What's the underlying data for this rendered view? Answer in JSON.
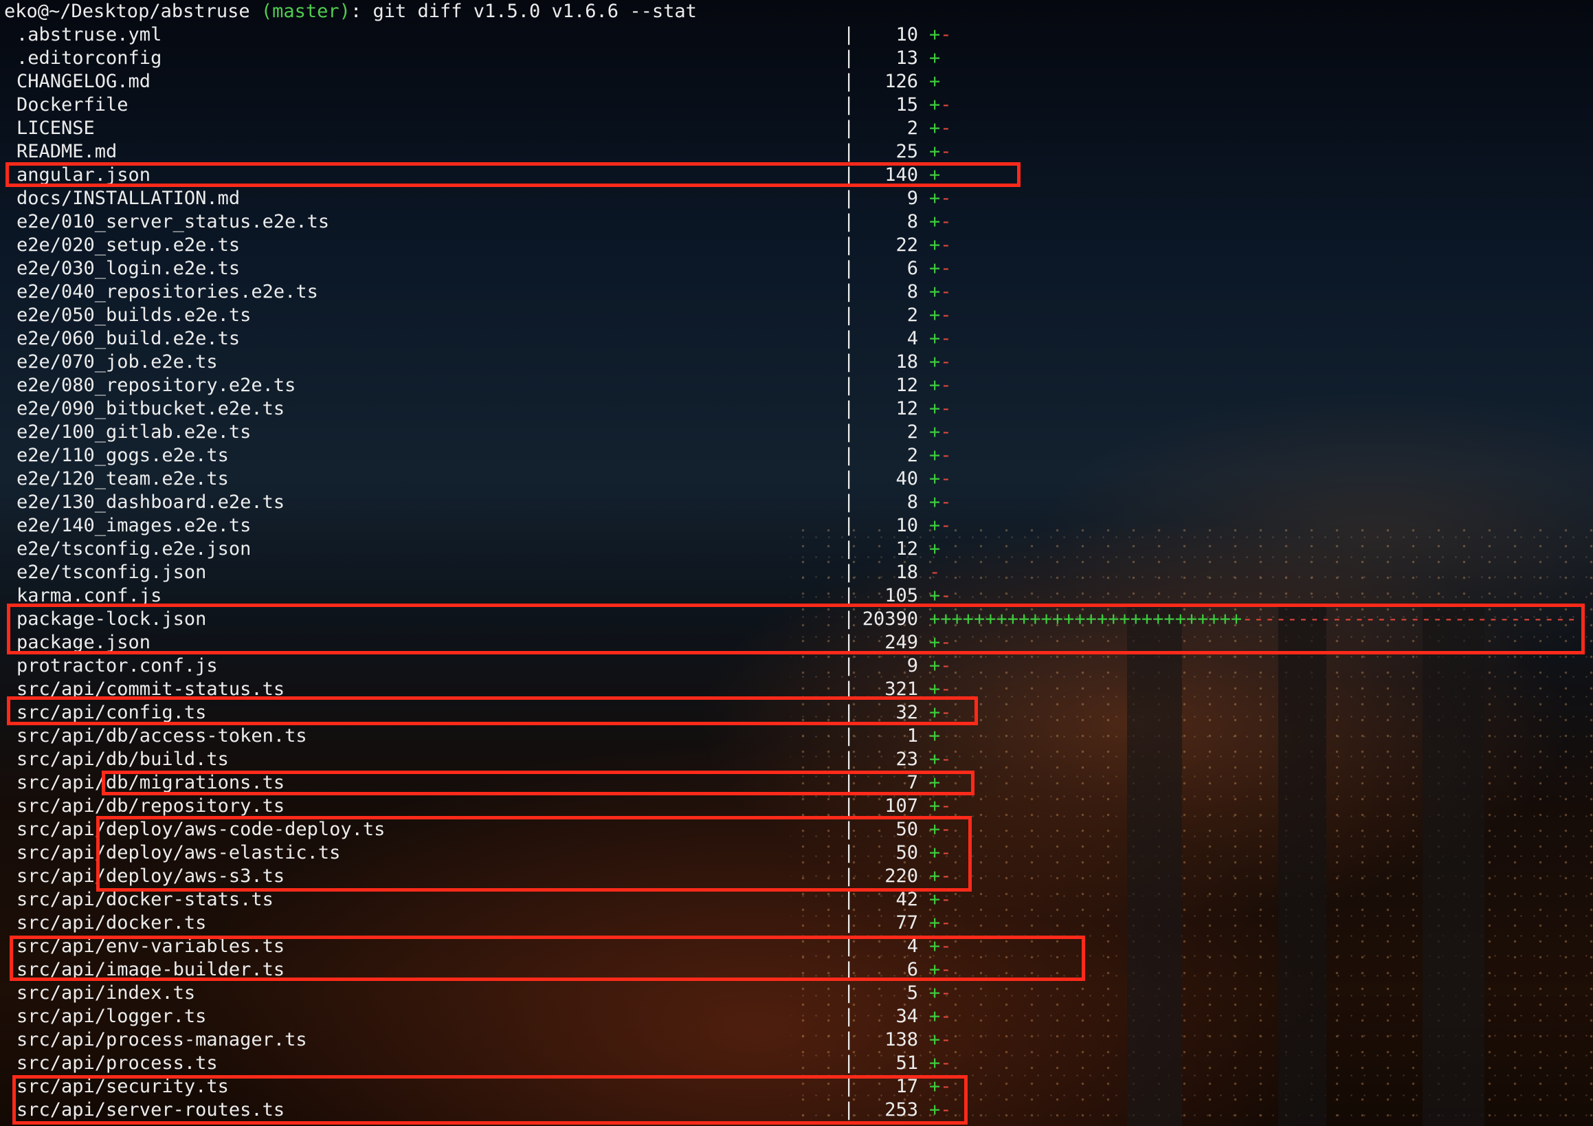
{
  "terminal": {
    "prompt_user": "eko@~/Desktop/abstruse",
    "prompt_branch": "(master)",
    "prompt_command": ": git diff v1.5.0 v1.6.6 --stat"
  },
  "files": [
    {
      "name": ".abstruse.yml",
      "count": "10",
      "plus": "+",
      "minus": "-"
    },
    {
      "name": ".editorconfig",
      "count": "13",
      "plus": "+",
      "minus": ""
    },
    {
      "name": "CHANGELOG.md",
      "count": "126",
      "plus": "+",
      "minus": ""
    },
    {
      "name": "Dockerfile",
      "count": "15",
      "plus": "+",
      "minus": "-"
    },
    {
      "name": "LICENSE",
      "count": "2",
      "plus": "+",
      "minus": "-"
    },
    {
      "name": "README.md",
      "count": "25",
      "plus": "+",
      "minus": "-"
    },
    {
      "name": "angular.json",
      "count": "140",
      "plus": "+",
      "minus": ""
    },
    {
      "name": "docs/INSTALLATION.md",
      "count": "9",
      "plus": "+",
      "minus": "-"
    },
    {
      "name": "e2e/010_server_status.e2e.ts",
      "count": "8",
      "plus": "+",
      "minus": "-"
    },
    {
      "name": "e2e/020_setup.e2e.ts",
      "count": "22",
      "plus": "+",
      "minus": "-"
    },
    {
      "name": "e2e/030_login.e2e.ts",
      "count": "6",
      "plus": "+",
      "minus": "-"
    },
    {
      "name": "e2e/040_repositories.e2e.ts",
      "count": "8",
      "plus": "+",
      "minus": "-"
    },
    {
      "name": "e2e/050_builds.e2e.ts",
      "count": "2",
      "plus": "+",
      "minus": "-"
    },
    {
      "name": "e2e/060_build.e2e.ts",
      "count": "4",
      "plus": "+",
      "minus": "-"
    },
    {
      "name": "e2e/070_job.e2e.ts",
      "count": "18",
      "plus": "+",
      "minus": "-"
    },
    {
      "name": "e2e/080_repository.e2e.ts",
      "count": "12",
      "plus": "+",
      "minus": "-"
    },
    {
      "name": "e2e/090_bitbucket.e2e.ts",
      "count": "12",
      "plus": "+",
      "minus": "-"
    },
    {
      "name": "e2e/100_gitlab.e2e.ts",
      "count": "2",
      "plus": "+",
      "minus": "-"
    },
    {
      "name": "e2e/110_gogs.e2e.ts",
      "count": "2",
      "plus": "+",
      "minus": "-"
    },
    {
      "name": "e2e/120_team.e2e.ts",
      "count": "40",
      "plus": "+",
      "minus": "-"
    },
    {
      "name": "e2e/130_dashboard.e2e.ts",
      "count": "8",
      "plus": "+",
      "minus": "-"
    },
    {
      "name": "e2e/140_images.e2e.ts",
      "count": "10",
      "plus": "+",
      "minus": "-"
    },
    {
      "name": "e2e/tsconfig.e2e.json",
      "count": "12",
      "plus": "+",
      "minus": ""
    },
    {
      "name": "e2e/tsconfig.json",
      "count": "18",
      "plus": "",
      "minus": "-"
    },
    {
      "name": "karma.conf.js",
      "count": "105",
      "plus": "+",
      "minus": "-"
    },
    {
      "name": "package-lock.json",
      "count": "20390",
      "plus": "++++++++++++++++++++++++++++",
      "minus": "------------------------------"
    },
    {
      "name": "package.json",
      "count": "249",
      "plus": "+",
      "minus": "-"
    },
    {
      "name": "protractor.conf.js",
      "count": "9",
      "plus": "+",
      "minus": "-"
    },
    {
      "name": "src/api/commit-status.ts",
      "count": "321",
      "plus": "+",
      "minus": "-"
    },
    {
      "name": "src/api/config.ts",
      "count": "32",
      "plus": "+",
      "minus": "-"
    },
    {
      "name": "src/api/db/access-token.ts",
      "count": "1",
      "plus": "+",
      "minus": ""
    },
    {
      "name": "src/api/db/build.ts",
      "count": "23",
      "plus": "+",
      "minus": "-"
    },
    {
      "name": "src/api/db/migrations.ts",
      "count": "7",
      "plus": "+",
      "minus": ""
    },
    {
      "name": "src/api/db/repository.ts",
      "count": "107",
      "plus": "+",
      "minus": "-"
    },
    {
      "name": "src/api/deploy/aws-code-deploy.ts",
      "count": "50",
      "plus": "+",
      "minus": "-"
    },
    {
      "name": "src/api/deploy/aws-elastic.ts",
      "count": "50",
      "plus": "+",
      "minus": "-"
    },
    {
      "name": "src/api/deploy/aws-s3.ts",
      "count": "220",
      "plus": "+",
      "minus": "-"
    },
    {
      "name": "src/api/docker-stats.ts",
      "count": "42",
      "plus": "+",
      "minus": "-"
    },
    {
      "name": "src/api/docker.ts",
      "count": "77",
      "plus": "+",
      "minus": "-"
    },
    {
      "name": "src/api/env-variables.ts",
      "count": "4",
      "plus": "+",
      "minus": "-"
    },
    {
      "name": "src/api/image-builder.ts",
      "count": "6",
      "plus": "+",
      "minus": "-"
    },
    {
      "name": "src/api/index.ts",
      "count": "5",
      "plus": "+",
      "minus": "-"
    },
    {
      "name": "src/api/logger.ts",
      "count": "34",
      "plus": "+",
      "minus": "-"
    },
    {
      "name": "src/api/process-manager.ts",
      "count": "138",
      "plus": "+",
      "minus": "-"
    },
    {
      "name": "src/api/process.ts",
      "count": "51",
      "plus": "+",
      "minus": "-"
    },
    {
      "name": "src/api/security.ts",
      "count": "17",
      "plus": "+",
      "minus": "-"
    },
    {
      "name": "src/api/server-routes.ts",
      "count": "253",
      "plus": "+",
      "minus": "-"
    }
  ],
  "colors": {
    "plus": "#3ecb3e",
    "minus": "#e0453a",
    "highlight": "#ff2a1a",
    "branch": "#4fcc4f"
  }
}
